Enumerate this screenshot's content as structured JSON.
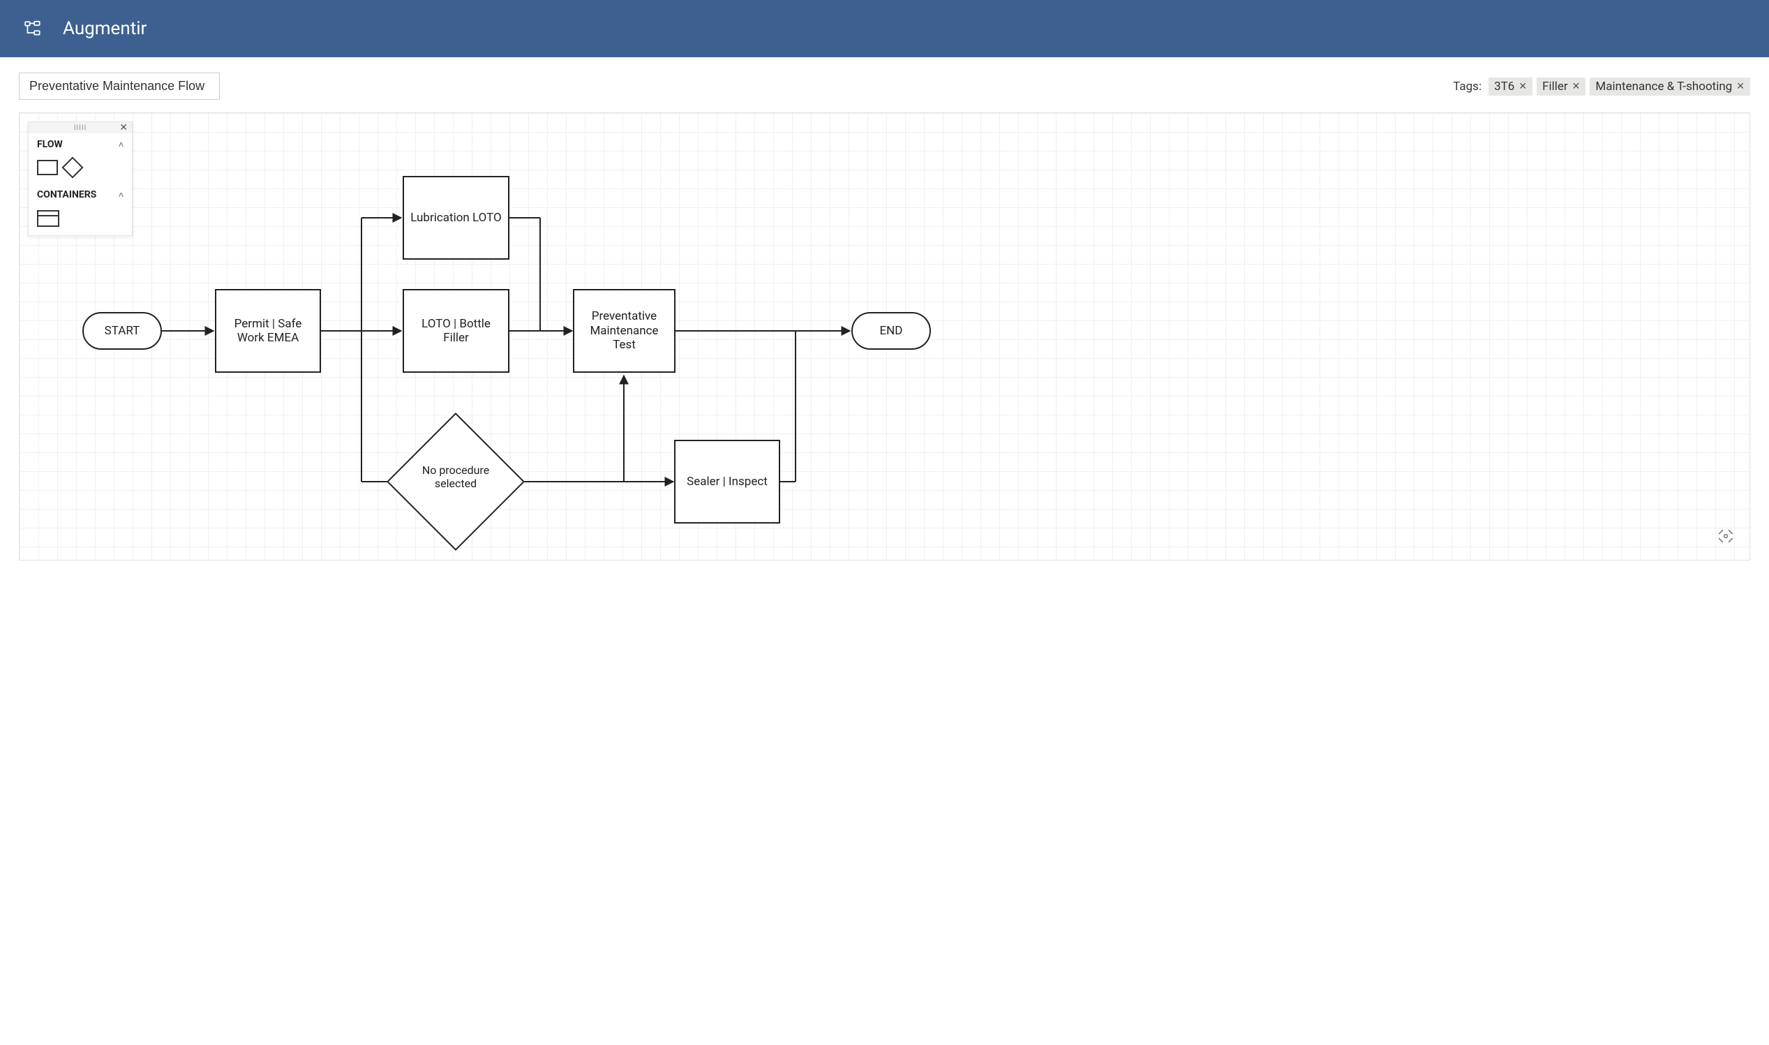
{
  "header": {
    "app_title": "Augmentir"
  },
  "flow": {
    "name": "Preventative Maintenance Flow"
  },
  "tags": {
    "label": "Tags:",
    "items": [
      "3T6",
      "Filler",
      "Maintenance & T-shooting"
    ]
  },
  "palette": {
    "sections": {
      "flow": "FLOW",
      "containers": "CONTAINERS"
    }
  },
  "nodes": {
    "start": "START",
    "permit": "Permit | Safe Work EMEA",
    "lub_loto": "Lubrication LOTO",
    "loto_filler": "LOTO | Bottle Filler",
    "no_proc": "No procedure selected",
    "pm_test": "Preventative Maintenance Test",
    "sealer": "Sealer | Inspect",
    "end": "END"
  }
}
